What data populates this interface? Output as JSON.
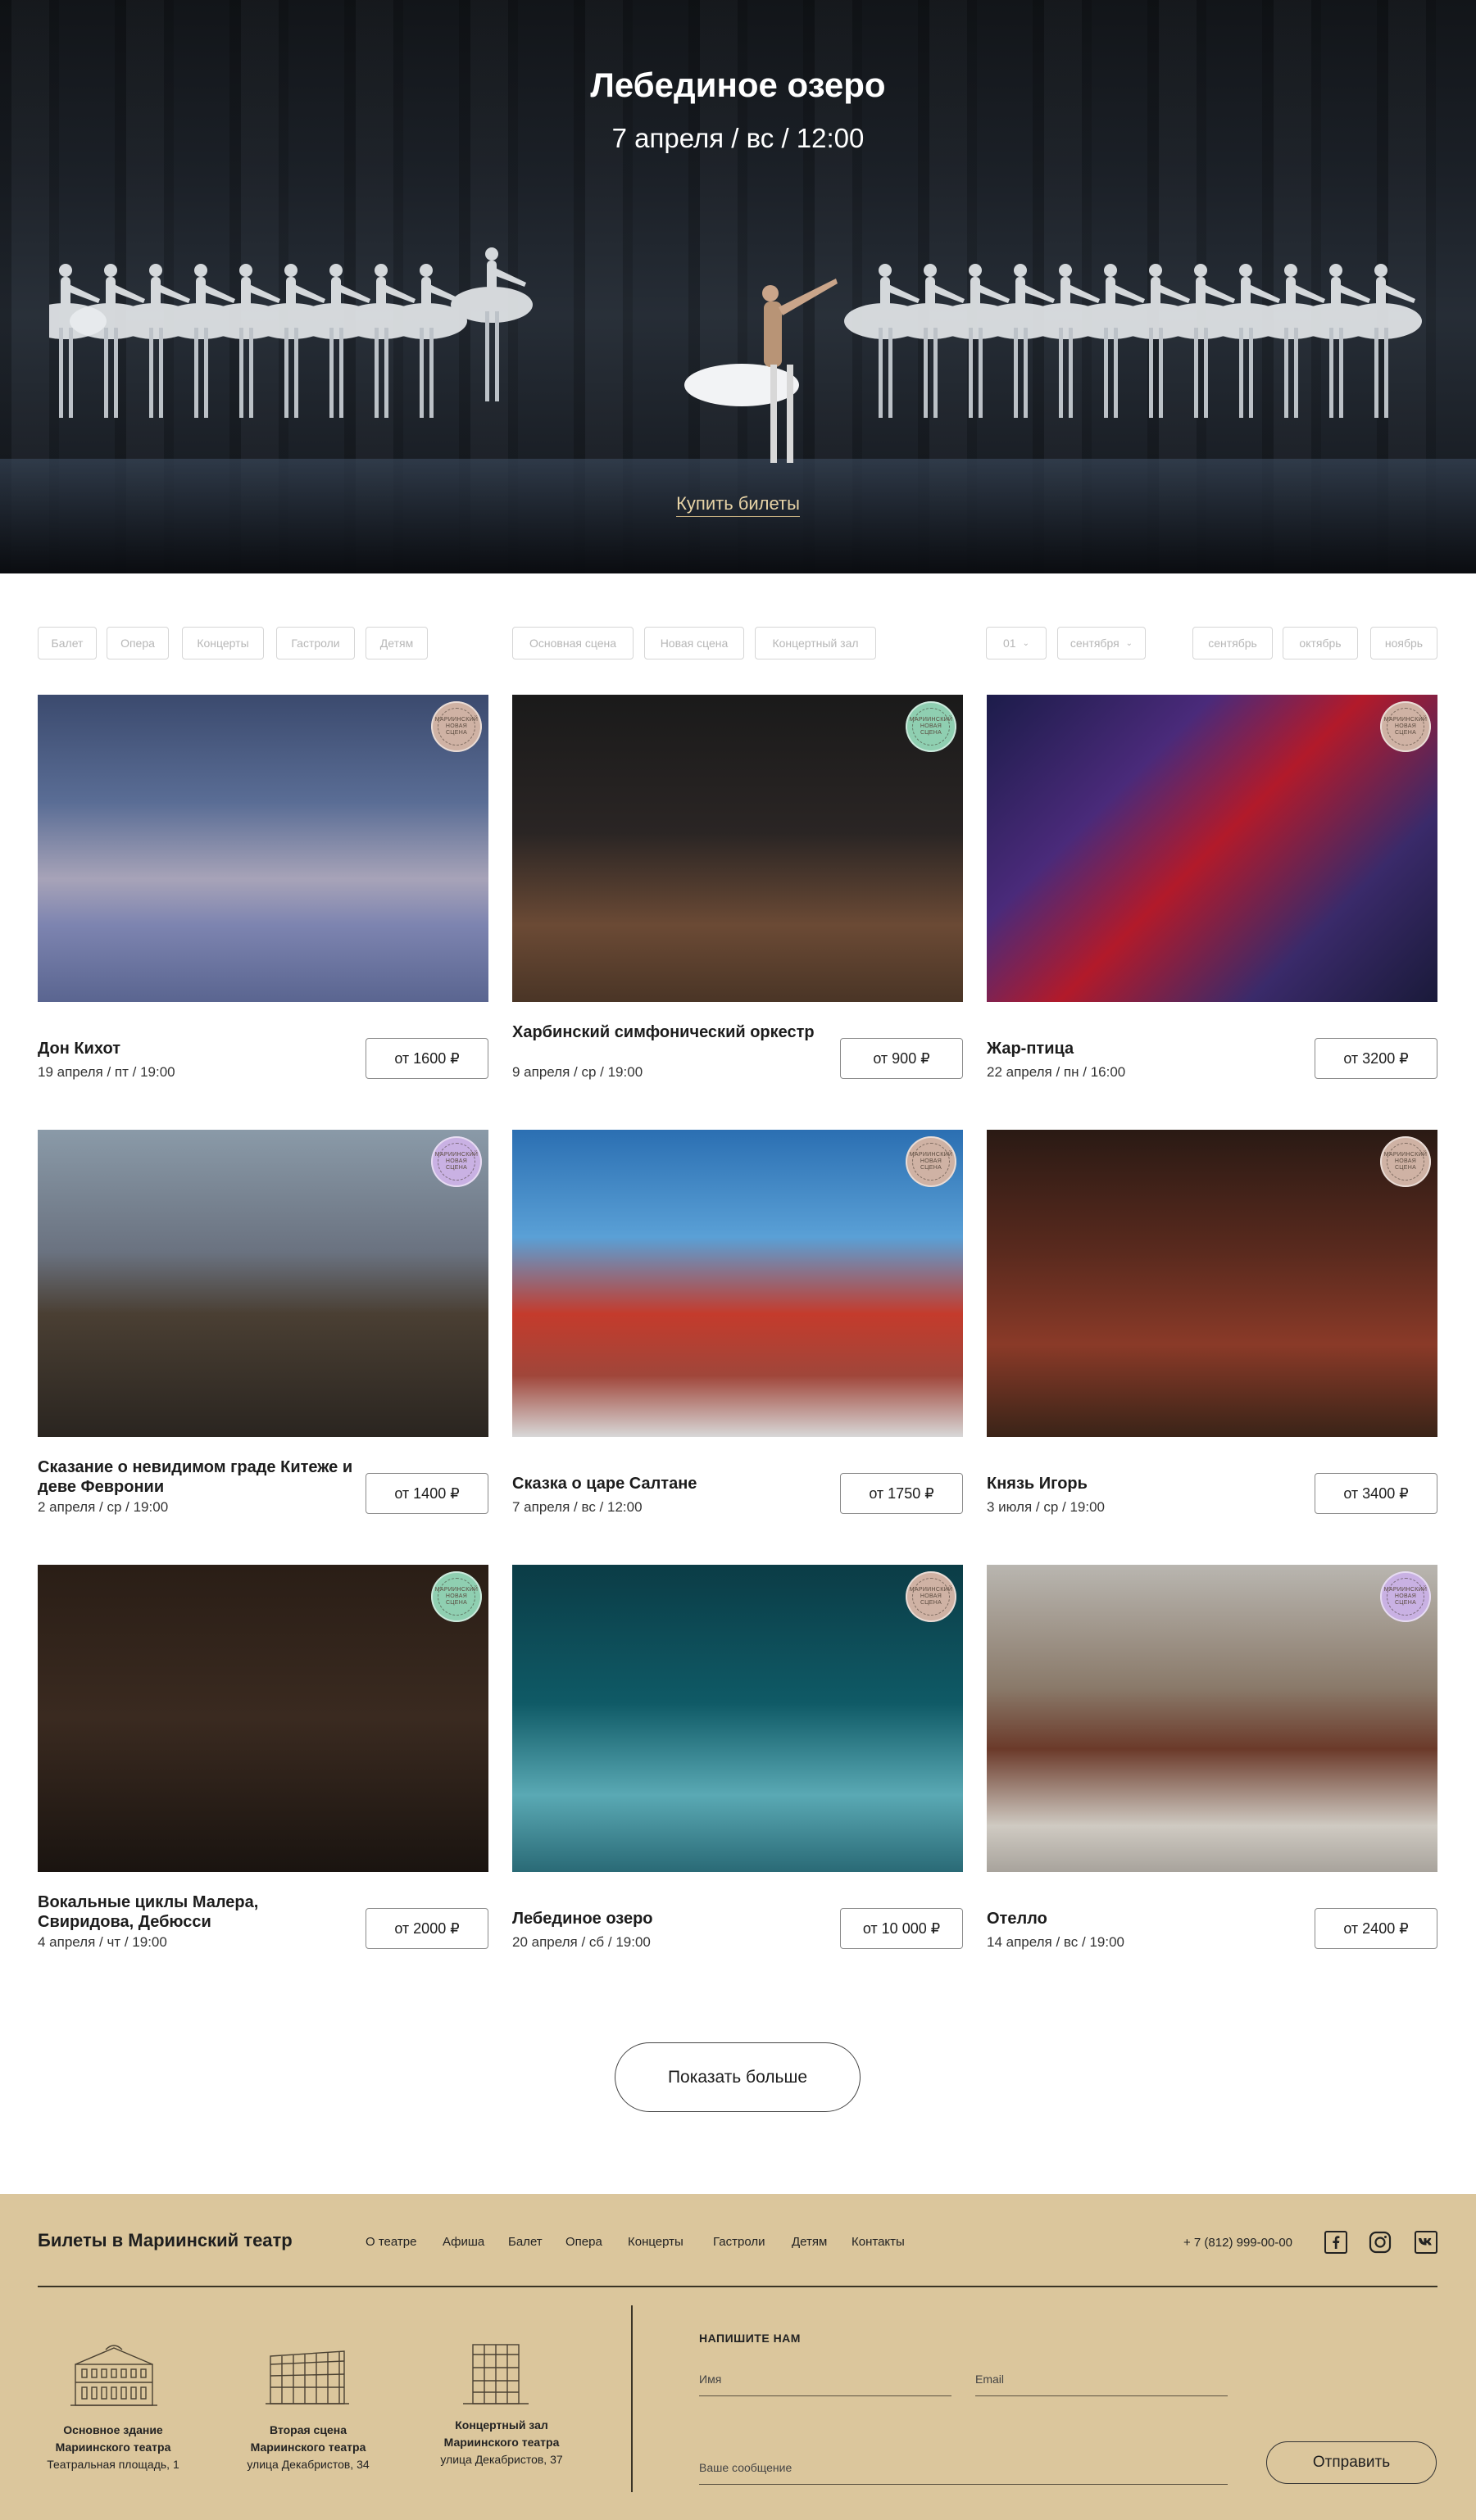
{
  "hero": {
    "title": "Лебединое озеро",
    "date": "7 апреля / вс / 12:00",
    "buy_label": "Купить билеты"
  },
  "filters": {
    "genres": [
      "Балет",
      "Опера",
      "Концерты",
      "Гастроли",
      "Детям"
    ],
    "venues": [
      "Основная сцена",
      "Новая сцена",
      "Концертный зал"
    ],
    "day_select": "01",
    "month_select": "сентября",
    "months": [
      "сентябрь",
      "октябрь",
      "ноябрь"
    ]
  },
  "events": [
    {
      "title": "Дон Кихот",
      "date": "19 апреля / пт / 19:00",
      "price": "от 1600 ₽",
      "badge_color": "#cfb2a4",
      "image": "don-quixote-scene"
    },
    {
      "title": "Харбинский симфонический оркестр",
      "date": "9 апреля / ср / 19:00",
      "price": "от 900 ₽",
      "badge_color": "#8fcfb1",
      "image": "orchestra-scene"
    },
    {
      "title": "Жар-птица",
      "date": "22 апреля / пн / 16:00",
      "price": "от 3200 ₽",
      "badge_color": "#cfb2a4",
      "image": "firebird-scene"
    },
    {
      "title": "Сказание о невидимом граде Китеже и деве Февронии",
      "date": "2 апреля / ср / 19:00",
      "price": "от 1400 ₽",
      "badge_color": "#c9b1e3",
      "image": "kitezh-scene"
    },
    {
      "title": "Сказка о царе Салтане",
      "date": "7 апреля / вс / 12:00",
      "price": "от 1750 ₽",
      "badge_color": "#cfb2a4",
      "image": "saltan-scene"
    },
    {
      "title": "Князь Игорь",
      "date": "3 июля / ср / 19:00",
      "price": "от 3400 ₽",
      "badge_color": "#cfb2a4",
      "image": "prince-igor-scene"
    },
    {
      "title": "Вокальные циклы Малера, Свиридова, Дебюсси",
      "date": "4 апреля / чт / 19:00",
      "price": "от 2000 ₽",
      "badge_color": "#8fcfb1",
      "image": "vocal-cycles-scene"
    },
    {
      "title": "Лебединое озеро",
      "date": "20 апреля / сб / 19:00",
      "price": "от 10 000 ₽",
      "badge_color": "#cfb2a4",
      "image": "swan-lake-scene"
    },
    {
      "title": "Отелло",
      "date": "14 апреля / вс / 19:00",
      "price": "от 2400 ₽",
      "badge_color": "#c9b1e3",
      "image": "othello-scene"
    }
  ],
  "badge_text": "МАРИИНСКИЙ НОВАЯ СЦЕНА",
  "show_more_label": "Показать больше",
  "footer": {
    "brand": "Билеты в Мариинский театр",
    "nav": [
      "О театре",
      "Афиша",
      "Балет",
      "Опера",
      "Концерты",
      "Гастроли",
      "Детям",
      "Контакты"
    ],
    "phone": "+ 7 (812) 999-00-00",
    "social": [
      "facebook-icon",
      "instagram-icon",
      "vk-icon"
    ],
    "buildings": [
      {
        "name1": "Основное здание",
        "name2": "Мариинского театра",
        "address": "Театральная площадь, 1"
      },
      {
        "name1": "Вторая сцена",
        "name2": "Мариинского театра",
        "address": "улица Декабристов, 34"
      },
      {
        "name1": "Концертный зал",
        "name2": "Мариинского театра",
        "address": "улица Декабристов, 37"
      }
    ],
    "form": {
      "heading": "НАПИШИТЕ НАМ",
      "name_placeholder": "Имя",
      "email_placeholder": "Email",
      "message_placeholder": "Ваше сообщение",
      "send_label": "Отправить"
    }
  }
}
